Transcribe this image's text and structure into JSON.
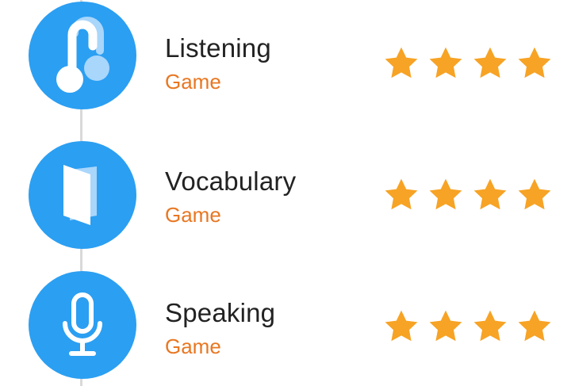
{
  "accent_color": "#2b9ff2",
  "subtitle_color": "#e87722",
  "star_color": "#f7a325",
  "items": [
    {
      "title": "Listening",
      "subtitle": "Game",
      "icon": "headphones-icon",
      "rating": 4,
      "rating_max": 4
    },
    {
      "title": "Vocabulary",
      "subtitle": "Game",
      "icon": "book-icon",
      "rating": 4,
      "rating_max": 4
    },
    {
      "title": "Speaking",
      "subtitle": "Game",
      "icon": "microphone-icon",
      "rating": 4,
      "rating_max": 4
    }
  ]
}
